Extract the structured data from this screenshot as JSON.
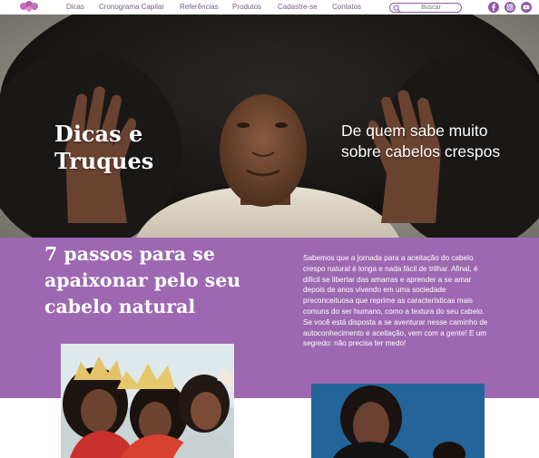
{
  "nav": {
    "logo_icon": "afro-hair-logo-icon",
    "links": [
      "Dicas",
      "Cronograma Capilar",
      "Referências",
      "Produtos",
      "Cadastre-se",
      "Contatos"
    ],
    "search_placeholder": "Buscar",
    "social_icons": [
      "facebook-icon",
      "instagram-icon",
      "youtube-icon"
    ]
  },
  "hero": {
    "title": "Dicas e Truques",
    "subtitle": "De quem sabe muito sobre cabelos crespos"
  },
  "article": {
    "title": "7 passos para se apaixonar pelo seu cabelo natural",
    "body": "Sabemos que a jornada para a aceitação do cabelo crespo natural é longa e nada fácil de trilhar. Afinal, é difícil se libertar das amarras e aprender a se amar depois de anos vivendo em uma sociedade preconceituosa que reprime as características mais comuns do ser humano, como a textura do seu cabelo. Se você está disposta a se aventurar nesse caminho de autoconhecimento e aceitação, vem com a gente! E um segredo: não precisa ter medo!"
  },
  "colors": {
    "brand_purple": "#9d68b1",
    "nav_text": "#7a5a8c",
    "white": "#ffffff"
  }
}
